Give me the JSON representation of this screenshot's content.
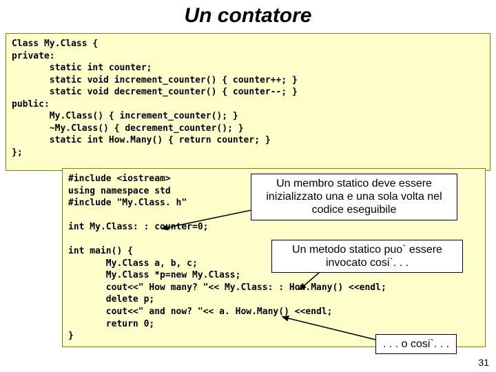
{
  "title": "Un contatore",
  "code_top": "Class My.Class {\nprivate:\n       static int counter;\n       static void increment_counter() { counter++; }\n       static void decrement_counter() { counter--; }\npublic:\n       My.Class() { increment_counter(); }\n       ~My.Class() { decrement_counter(); }\n       static int How.Many() { return counter; }\n};",
  "code_bottom": "#include <iostream>\nusing namespace std\n#include \"My.Class. h\"\n\nint My.Class: : counter=0;\n\nint main() {\n       My.Class a, b, c;\n       My.Class *p=new My.Class;\n       cout<<\" How many? \"<< My.Class: : How.Many() <<endl;\n       delete p;\n       cout<<\" and now? \"<< a. How.Many() <<endl;\n       return 0;\n}",
  "note1": "Un membro statico deve essere inizializzato una e una sola volta nel codice eseguibile",
  "note2": "Un metodo statico puo` essere invocato cosi`. . .",
  "note3": ". . . o cosi`. . .",
  "page_number": "31"
}
